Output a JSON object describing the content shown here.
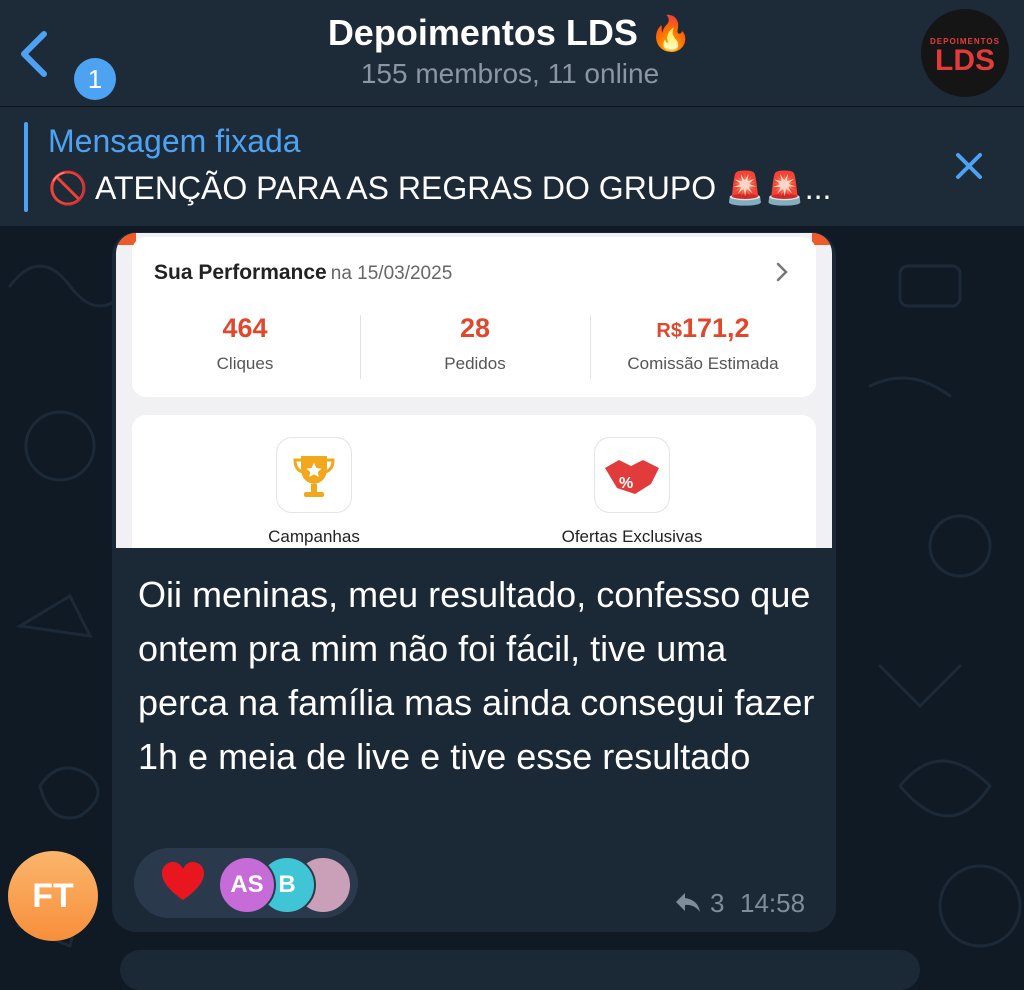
{
  "header": {
    "back_badge": "1",
    "title": "Depoimentos LDS",
    "title_emoji": "🔥",
    "subtitle": "155 membros, 11 online",
    "avatar_small": "DEPOIMENTOS",
    "avatar_big": "LDS"
  },
  "pinned": {
    "label": "Mensagem fixada",
    "text": "🚫 ATENÇÃO PARA AS REGRAS DO GRUPO 🚨🚨..."
  },
  "message": {
    "image": {
      "title": "Sua Performance",
      "date": "na 15/03/2025",
      "stats": [
        {
          "value": "464",
          "label": "Cliques"
        },
        {
          "value": "28",
          "label": "Pedidos"
        },
        {
          "currency": "R$",
          "value": "171,2",
          "label": "Comissão Estimada"
        }
      ],
      "features": [
        {
          "label": "Campanhas",
          "icon": "trophy-icon"
        },
        {
          "label": "Ofertas Exclusivas",
          "icon": "handshake-icon"
        }
      ]
    },
    "text": "Oii meninas, meu resultado, confesso que ontem pra mim não foi fácil, tive uma perca na família mas ainda consegui fazer 1h e meia de live e tive esse resultado",
    "reactions": {
      "emoji": "heart-icon",
      "avatars": [
        {
          "initials": "AS",
          "color": "#c76bd8"
        },
        {
          "initials": "B",
          "color": "#3fc5d6"
        },
        {
          "initials": "",
          "color": "#c9a0b8"
        }
      ]
    },
    "reply_count": "3",
    "time": "14:58",
    "sender_initials": "FT"
  },
  "colors": {
    "accent": "#4da3f2",
    "header_bg": "#1d2a38",
    "bubble_bg": "#1b2835",
    "stat_red": "#e0472d"
  }
}
